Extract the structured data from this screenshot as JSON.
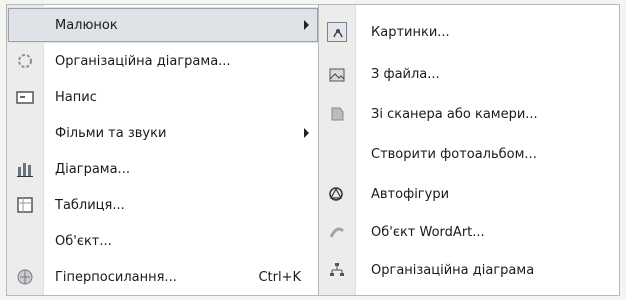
{
  "main_menu": {
    "items": [
      {
        "label": "Малюнок",
        "has_submenu": true,
        "highlighted": true,
        "icon": "none"
      },
      {
        "label": "Організаційна діаграма...",
        "icon": "org-chart-icon"
      },
      {
        "label": "Напис",
        "icon": "text-box-icon"
      },
      {
        "label": "Фільми та звуки",
        "has_submenu": true,
        "icon": "none"
      },
      {
        "label": "Діаграма...",
        "icon": "chart-icon"
      },
      {
        "label": "Таблиця...",
        "icon": "table-icon"
      },
      {
        "label": "Об'єкт...",
        "icon": "none"
      },
      {
        "label": "Гіперпосилання...",
        "shortcut": "Ctrl+K",
        "icon": "hyperlink-icon"
      }
    ]
  },
  "picture_submenu": {
    "items": [
      {
        "label": "Картинки...",
        "icon": "clip-art-icon"
      },
      {
        "label": "З файла...",
        "icon": "picture-file-icon"
      },
      {
        "label": "Зі сканера або камери...",
        "icon": "scanner-icon"
      },
      {
        "label": "Створити фотоальбом...",
        "icon": "none"
      },
      {
        "label": "Автофігури",
        "icon": "autoshapes-icon"
      },
      {
        "label": "Об'єкт WordArt...",
        "icon": "wordart-icon"
      },
      {
        "label": "Організаційна діаграма",
        "icon": "org-chart-icon"
      }
    ]
  },
  "colors": {
    "highlight": "#dfe3e8",
    "icon_strip": "#ececea",
    "menu_border": "#b9b9b9"
  }
}
